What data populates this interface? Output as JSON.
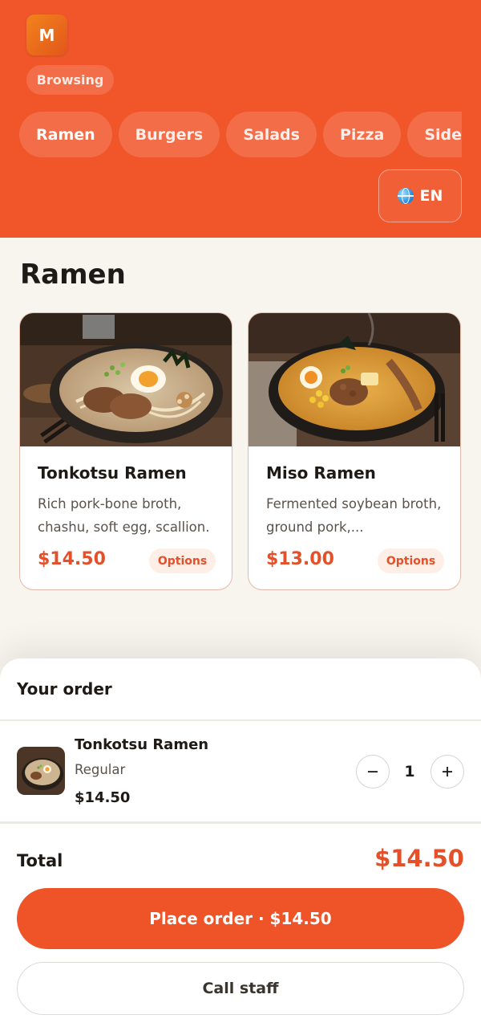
{
  "header": {
    "logo_letter": "M",
    "status": "Browsing",
    "categories": [
      "Ramen",
      "Burgers",
      "Salads",
      "Pizza",
      "Sides"
    ],
    "active_category": "Ramen",
    "language": "EN",
    "brand_color": "#f0562a"
  },
  "section": {
    "title": "Ramen"
  },
  "menu_items": [
    {
      "name": "Tonkotsu Ramen",
      "description": "Rich pork-bone broth, chashu, soft egg, scallion.",
      "price": "$14.50",
      "options_label": "Options"
    },
    {
      "name": "Miso Ramen",
      "description": "Fermented soybean broth, ground pork,...",
      "price": "$13.00",
      "options_label": "Options"
    }
  ],
  "order": {
    "title": "Your order",
    "items": [
      {
        "name": "Tonkotsu Ramen",
        "variant": "Regular",
        "price": "$14.50",
        "quantity": "1"
      }
    ],
    "total_label": "Total",
    "total_value": "$14.50",
    "place_order_label": "Place order · $14.50",
    "call_staff_label": "Call staff"
  },
  "icons": {
    "language": "globe-icon",
    "decrease": "minus-icon",
    "increase": "plus-icon"
  }
}
